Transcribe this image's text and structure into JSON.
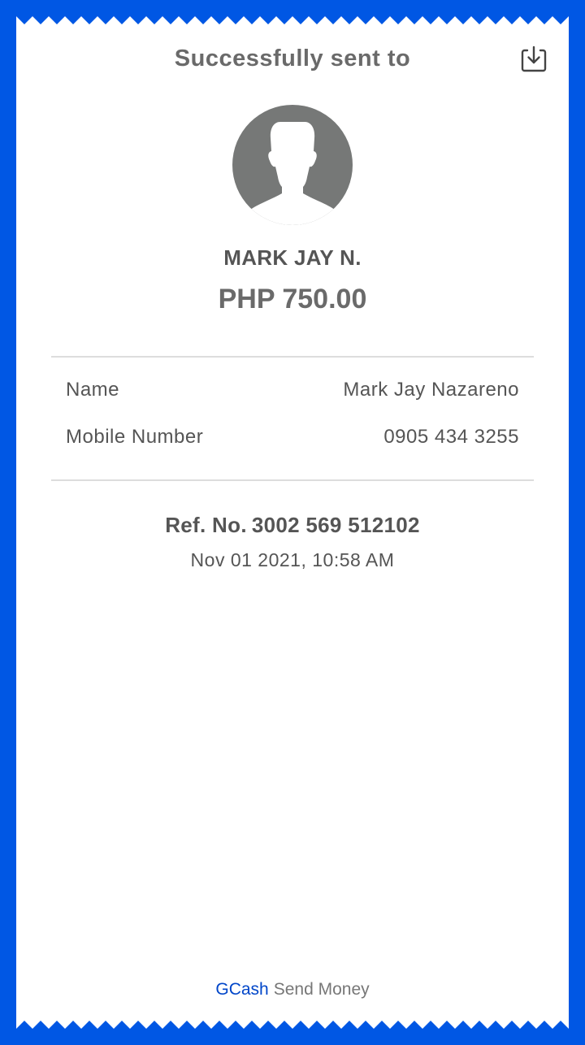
{
  "colors": {
    "background": "#0057e4",
    "card": "#ffffff",
    "brand": "#0046c9",
    "text": "#555555"
  },
  "header": {
    "title": "Successfully sent to",
    "download_icon": "download-icon"
  },
  "recipient": {
    "avatar_icon": "avatar-placeholder-icon",
    "short_name": "MARK JAY N.",
    "amount": "PHP 750.00"
  },
  "details": [
    {
      "label": "Name",
      "value": "Mark Jay Nazareno"
    },
    {
      "label": "Mobile Number",
      "value": "0905 434 3255"
    }
  ],
  "reference": {
    "label": "Ref. No.",
    "number": "3002 569 512102",
    "datetime": "Nov 01 2021, 10:58 AM"
  },
  "footer": {
    "brand": "GCash",
    "text": "Send Money"
  }
}
